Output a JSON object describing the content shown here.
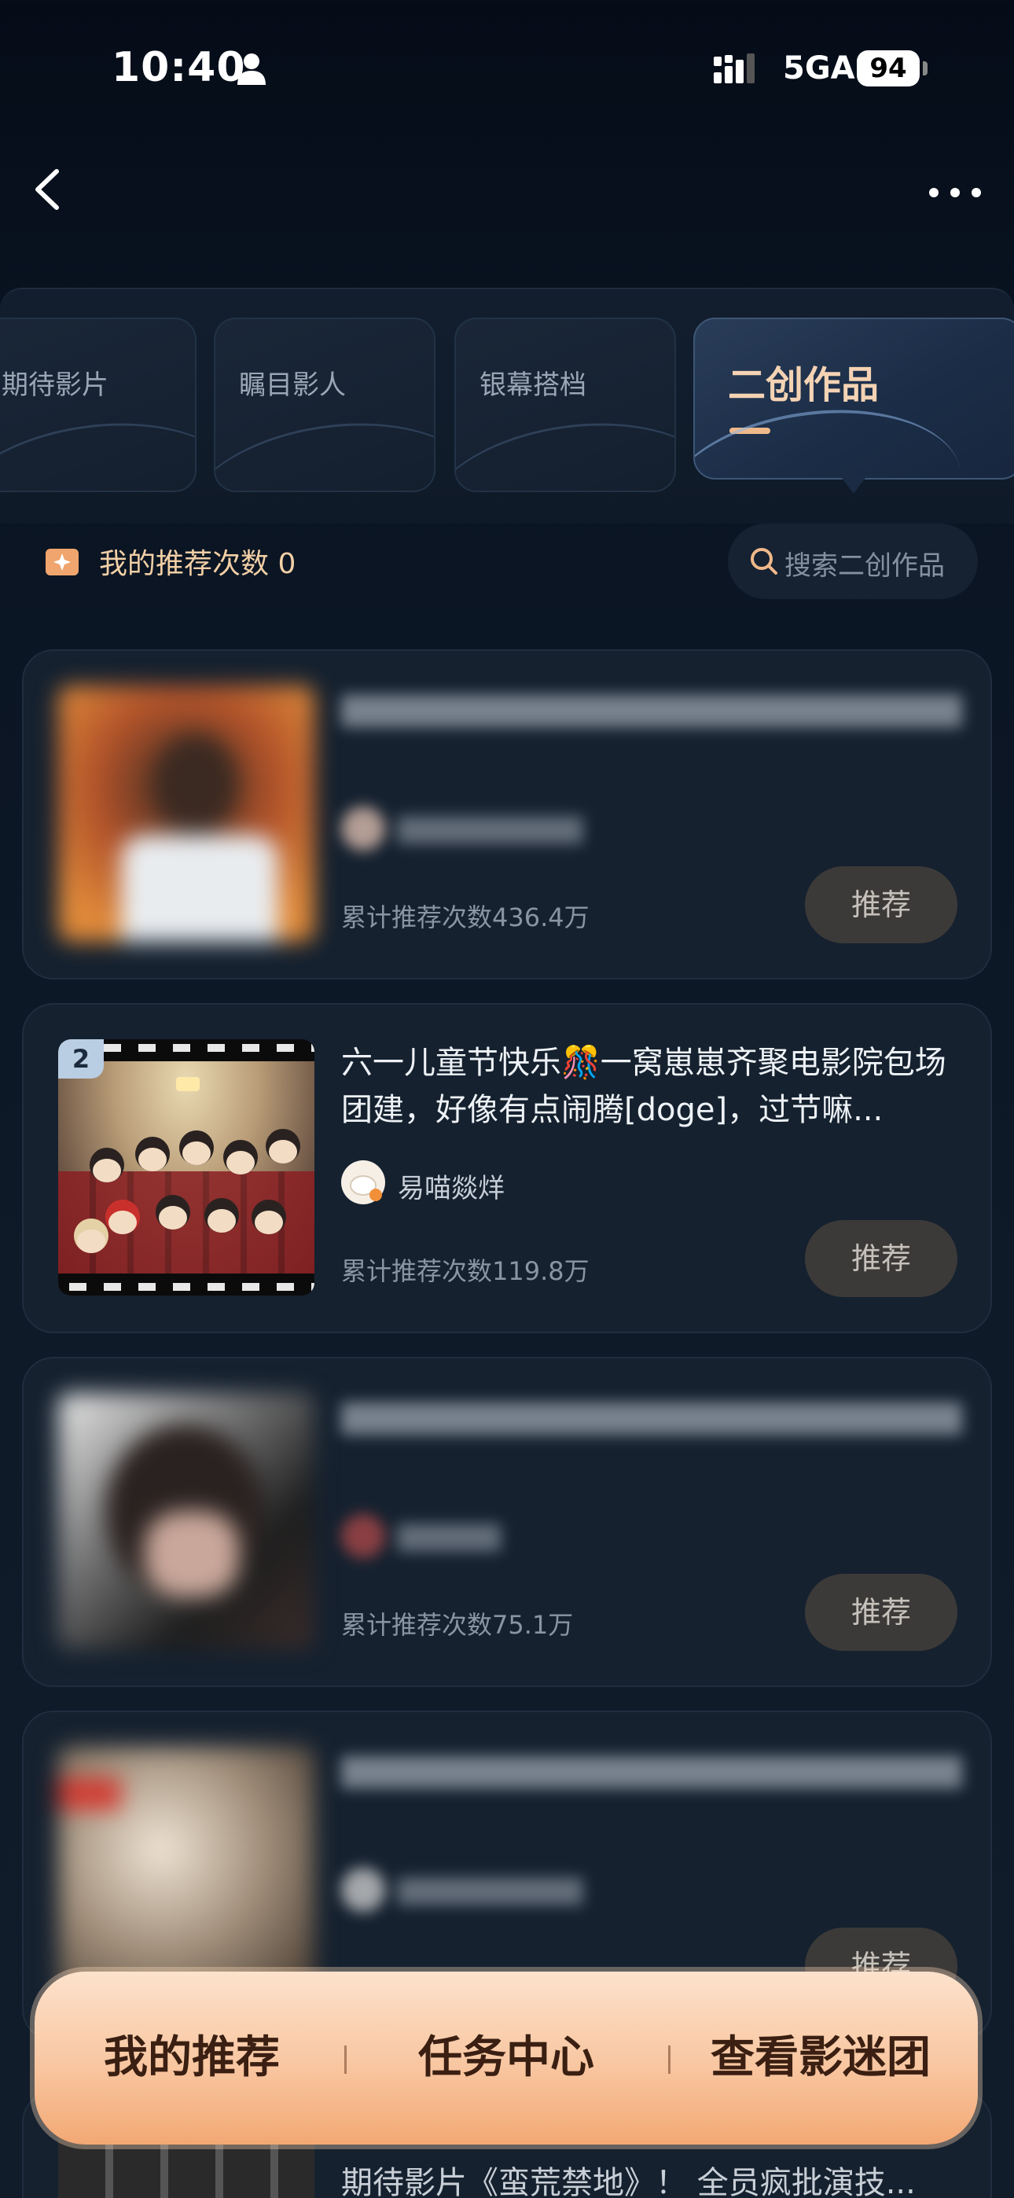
{
  "status_bar": {
    "time": "10:40",
    "network": "5GA",
    "battery": "94"
  },
  "tabs": [
    {
      "label": "期待影片"
    },
    {
      "label": "瞩目影人"
    },
    {
      "label": "银幕搭档"
    },
    {
      "label": "二创作品",
      "active": true
    }
  ],
  "recommend_summary": {
    "label": "我的推荐次数 0"
  },
  "search": {
    "placeholder": "搜索二创作品"
  },
  "cards": [
    {
      "title": "",
      "author": "",
      "count": "累计推荐次数436.4万",
      "button": "推荐",
      "blurred": true
    },
    {
      "rank": "2",
      "title": "六一儿童节快乐🎊一窝崽崽齐聚电影院包场团建，好像有点闹腾[doge]，过节嘛...",
      "author": "易喵燚烊",
      "count": "累计推荐次数119.8万",
      "button": "推荐",
      "blurred": false
    },
    {
      "title": "",
      "author": "",
      "count": "累计推荐次数75.1万",
      "button": "推荐",
      "blurred": true
    },
    {
      "title": "",
      "author": "",
      "count": "",
      "button": "推荐",
      "blurred": true
    },
    {
      "title": "期待影片《蛮荒禁地》！ 全员疯批演技..."
    }
  ],
  "bottom_bar": {
    "my_recommend": "我的推荐",
    "task_center": "任务中心",
    "fan_club": "查看影迷团"
  },
  "colors": {
    "accent": "#f4d3b4",
    "background": "#0e1a28",
    "button": "#3c3a38",
    "cta_gradient": "#f8c6a0"
  }
}
